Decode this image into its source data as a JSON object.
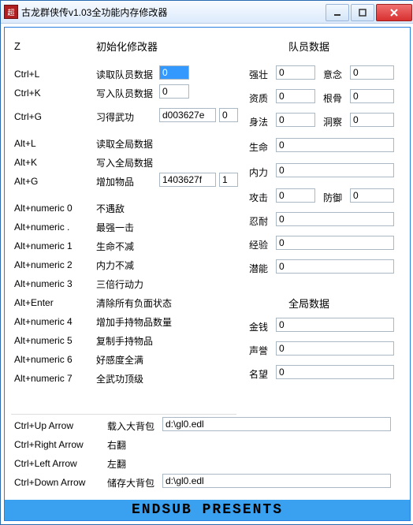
{
  "title": "古龙群侠传v1.03全功能内存修改器",
  "app_icon_text": "超",
  "headings": {
    "init": "初始化修改器",
    "member": "队员数据",
    "global": "全局数据"
  },
  "left": {
    "z": "Z",
    "rows": [
      {
        "key": "Ctrl+L",
        "label": "读取队员数据",
        "input": "0"
      },
      {
        "key": "Ctrl+K",
        "label": "写入队员数据",
        "input": "0"
      },
      {
        "key": "Ctrl+G",
        "label": "习得武功",
        "input": "d003627e",
        "input2": "0"
      },
      {
        "key": "Alt+L",
        "label": "读取全局数据"
      },
      {
        "key": "Alt+K",
        "label": "写入全局数据"
      },
      {
        "key": "Alt+G",
        "label": "增加物品",
        "input": "1403627f",
        "input2": "1"
      },
      {
        "key": "Alt+numeric 0",
        "label": "不遇敌"
      },
      {
        "key": "Alt+numeric .",
        "label": "最强一击"
      },
      {
        "key": "Alt+numeric 1",
        "label": "生命不减"
      },
      {
        "key": "Alt+numeric 2",
        "label": "内力不减"
      },
      {
        "key": "Alt+numeric 3",
        "label": "三倍行动力"
      },
      {
        "key": "Alt+Enter",
        "label": "清除所有负面状态"
      },
      {
        "key": "Alt+numeric 4",
        "label": "增加手持物品数量"
      },
      {
        "key": "Alt+numeric 5",
        "label": "复制手持物品"
      },
      {
        "key": "Alt+numeric 6",
        "label": "好感度全满"
      },
      {
        "key": "Alt+numeric 7",
        "label": "全武功顶级"
      }
    ],
    "bottom": [
      {
        "key": "Ctrl+Up Arrow",
        "label": "载入大背包",
        "input": "d:\\gl0.edl"
      },
      {
        "key": "Ctrl+Right Arrow",
        "label": "右翻"
      },
      {
        "key": "Ctrl+Left Arrow",
        "label": "左翻"
      },
      {
        "key": "Ctrl+Down Arrow",
        "label": "储存大背包",
        "input": "d:\\gl0.edl"
      }
    ]
  },
  "member": [
    {
      "label": "强壮",
      "value": "0",
      "label2": "意念",
      "value2": "0"
    },
    {
      "label": "资质",
      "value": "0",
      "label2": "根骨",
      "value2": "0"
    },
    {
      "label": "身法",
      "value": "0",
      "label2": "洞察",
      "value2": "0"
    },
    {
      "label": "生命",
      "value": "0"
    },
    {
      "label": "内力",
      "value": "0"
    },
    {
      "label": "攻击",
      "value": "0",
      "label2": "防御",
      "value2": "0"
    },
    {
      "label": "忍耐",
      "value": "0"
    },
    {
      "label": "经验",
      "value": "0"
    },
    {
      "label": "潜能",
      "value": "0"
    }
  ],
  "global": [
    {
      "label": "金钱",
      "value": "0"
    },
    {
      "label": "声誉",
      "value": "0"
    },
    {
      "label": "名望",
      "value": "0"
    }
  ],
  "footer": "ENDSUB PRESENTS"
}
